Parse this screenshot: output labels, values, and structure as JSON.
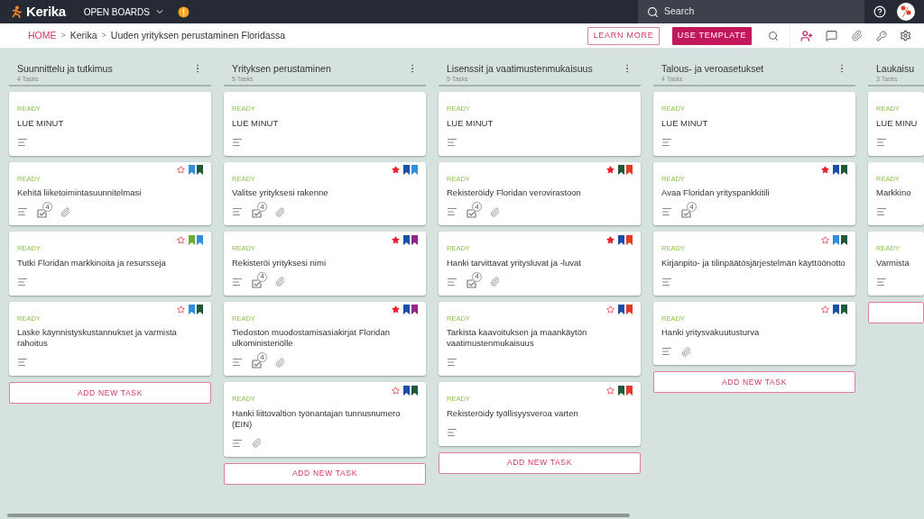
{
  "topbar": {
    "logo": "Kerika",
    "boards_menu": "OPEN BOARDS",
    "search": {
      "placeholder": "Search"
    }
  },
  "breadcrumb": [
    {
      "kind": "link",
      "text": "HOME"
    },
    {
      "kind": "separator",
      "text": ">"
    },
    {
      "kind": "link",
      "text": "Kerika"
    },
    {
      "kind": "separator",
      "text": ">"
    },
    {
      "kind": "link",
      "text": "Uuden yrityksen perustaminen Floridassa"
    }
  ],
  "actions": {
    "learn_more": "LEARN MORE",
    "use_template": "USE TEMPLATE"
  },
  "columns": [
    {
      "title": "Suunnittelu ja tutkimus",
      "count": "4 Tasks",
      "add_label": "ADD NEW TASK",
      "cards": [
        {
          "status": "READY",
          "title": "LUE MINUT",
          "badges": [
            {
              "kind": "notes"
            }
          ]
        },
        {
          "status": "READY",
          "title": "Kehitä liiketoimintasuunnitelmasi",
          "starred": false,
          "tags": [
            {
              "color": "#2f8fdc"
            },
            {
              "color": "#1e5a3a"
            }
          ],
          "badges": [
            {
              "kind": "notes"
            },
            {
              "kind": "checklist",
              "count": "4"
            },
            {
              "kind": "attachment"
            }
          ]
        },
        {
          "status": "READY",
          "title": "Tutki Floridan markkinoita ja resursseja",
          "starred": false,
          "tags": [
            {
              "color": "#6aab3a"
            },
            {
              "color": "#2f8fdc"
            }
          ],
          "badges": [
            {
              "kind": "notes"
            }
          ]
        },
        {
          "status": "READY",
          "title": "Laske käynnistyskustannukset ja varmista rahoitus",
          "starred": false,
          "tags": [
            {
              "color": "#2f8fdc"
            },
            {
              "color": "#1e5a3a"
            }
          ],
          "badges": [
            {
              "kind": "notes"
            }
          ]
        }
      ]
    },
    {
      "title": "Yrityksen perustaminen",
      "count": "5 Tasks",
      "add_label": "ADD NEW TASK",
      "cards": [
        {
          "status": "READY",
          "title": "LUE MINUT",
          "badges": [
            {
              "kind": "notes"
            }
          ]
        },
        {
          "status": "READY",
          "title": "Valitse yrityksesi rakenne",
          "starred": true,
          "tags": [
            {
              "color": "#1a4fa8"
            },
            {
              "color": "#2f8fdc"
            }
          ],
          "badges": [
            {
              "kind": "notes"
            },
            {
              "kind": "checklist",
              "count": "4"
            },
            {
              "kind": "attachment"
            }
          ]
        },
        {
          "status": "READY",
          "title": "Rekisteröi yrityksesi nimi",
          "starred": true,
          "tags": [
            {
              "color": "#1a4fa8"
            },
            {
              "color": "#8e2a8c"
            }
          ],
          "badges": [
            {
              "kind": "notes"
            },
            {
              "kind": "checklist",
              "count": "4"
            },
            {
              "kind": "attachment"
            }
          ]
        },
        {
          "status": "READY",
          "title": "Tiedoston muodostamisasiakirjat Floridan ulkoministeriölle",
          "starred": true,
          "tags": [
            {
              "color": "#1a4fa8"
            },
            {
              "color": "#8e2a8c"
            }
          ],
          "badges": [
            {
              "kind": "notes"
            },
            {
              "kind": "checklist",
              "count": "4"
            },
            {
              "kind": "attachment"
            }
          ]
        },
        {
          "status": "READY",
          "title": "Hanki liittovaltion työnantajan tunnusnumero (EIN)",
          "starred": false,
          "tags": [
            {
              "color": "#1a4fa8"
            },
            {
              "color": "#1e5a3a"
            }
          ],
          "badges": [
            {
              "kind": "notes"
            },
            {
              "kind": "attachment"
            }
          ]
        }
      ]
    },
    {
      "title": "Lisenssit ja vaatimustenmukaisuus",
      "count": "5 Tasks",
      "add_label": "ADD NEW TASK",
      "cards": [
        {
          "status": "READY",
          "title": "LUE MINUT",
          "badges": [
            {
              "kind": "notes"
            }
          ]
        },
        {
          "status": "READY",
          "title": "Rekisteröidy Floridan verovirastoon",
          "starred": true,
          "tags": [
            {
              "color": "#1e5a3a"
            },
            {
              "color": "#e03a2a"
            }
          ],
          "badges": [
            {
              "kind": "notes"
            },
            {
              "kind": "checklist",
              "count": "4"
            },
            {
              "kind": "attachment"
            }
          ]
        },
        {
          "status": "READY",
          "title": "Hanki tarvittavat yritysluvat ja -luvat",
          "starred": true,
          "tags": [
            {
              "color": "#1a4fa8"
            },
            {
              "color": "#e03a2a"
            }
          ],
          "badges": [
            {
              "kind": "notes"
            },
            {
              "kind": "checklist",
              "count": "4"
            },
            {
              "kind": "attachment"
            }
          ]
        },
        {
          "status": "READY",
          "title": "Tarkista kaavoituksen ja maankäytön vaatimustenmukaisuus",
          "starred": false,
          "tags": [
            {
              "color": "#1a4fa8"
            },
            {
              "color": "#e03a2a"
            }
          ],
          "badges": [
            {
              "kind": "notes"
            }
          ]
        },
        {
          "status": "READY",
          "title": "Rekisteröidy työllisyysveroa varten",
          "starred": false,
          "tags": [
            {
              "color": "#1e5a3a"
            },
            {
              "color": "#e03a2a"
            }
          ],
          "badges": [
            {
              "kind": "notes"
            }
          ]
        }
      ]
    },
    {
      "title": "Talous- ja veroasetukset",
      "count": "4 Tasks",
      "add_label": "ADD NEW TASK",
      "cards": [
        {
          "status": "READY",
          "title": "LUE MINUT",
          "badges": [
            {
              "kind": "notes"
            }
          ]
        },
        {
          "status": "READY",
          "title": "Avaa Floridan yrityspankkitili",
          "starred": true,
          "tags": [
            {
              "color": "#1a4fa8"
            },
            {
              "color": "#1e5a3a"
            }
          ],
          "badges": [
            {
              "kind": "notes"
            },
            {
              "kind": "checklist",
              "count": "4"
            }
          ]
        },
        {
          "status": "READY",
          "title": "Kirjanpito- ja tilinpäätösjärjestelmän käyttöönotto",
          "starred": false,
          "tags": [
            {
              "color": "#2f8fdc"
            },
            {
              "color": "#1e5a3a"
            }
          ],
          "badges": [
            {
              "kind": "notes"
            }
          ]
        },
        {
          "status": "READY",
          "title": "Hanki yritysvakuutusturva",
          "starred": false,
          "tags": [
            {
              "color": "#1a4fa8"
            },
            {
              "color": "#1e5a3a"
            }
          ],
          "badges": [
            {
              "kind": "notes"
            },
            {
              "kind": "attachment"
            }
          ]
        }
      ]
    },
    {
      "title": "Laukaisu",
      "count": "3 Tasks",
      "cards": [
        {
          "status": "READY",
          "title": "LUE MINU",
          "badges": [
            {
              "kind": "notes"
            }
          ]
        },
        {
          "status": "READY",
          "title": "Markkino",
          "badges": [
            {
              "kind": "notes"
            }
          ]
        },
        {
          "status": "READY",
          "title": "Varmista",
          "badges": [
            {
              "kind": "notes"
            }
          ]
        }
      ]
    }
  ]
}
